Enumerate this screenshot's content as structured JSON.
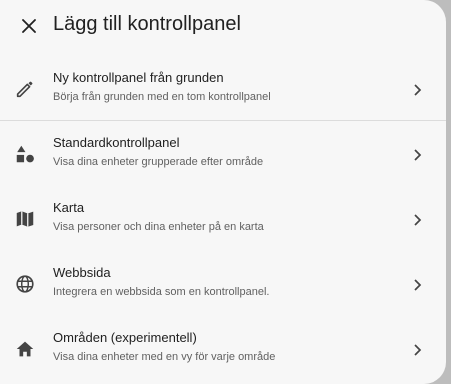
{
  "dialog": {
    "title": "Lägg till kontrollpanel",
    "close_icon": "close-icon"
  },
  "items": [
    {
      "label": "Ny kontrollpanel från grunden",
      "description": "Börja från grunden med en tom kontrollpanel",
      "icon": "pencil-icon"
    },
    {
      "label": "Standardkontrollpanel",
      "description": "Visa dina enheter grupperade efter område",
      "icon": "shapes-icon"
    },
    {
      "label": "Karta",
      "description": "Visa personer och dina enheter på en karta",
      "icon": "map-icon"
    },
    {
      "label": "Webbsida",
      "description": "Integrera en webbsida som en kontrollpanel.",
      "icon": "web-icon"
    },
    {
      "label": "Områden (experimentell)",
      "description": "Visa dina enheter med en vy för varje område",
      "icon": "home-icon"
    }
  ],
  "colors": {
    "dialog_bg": "#f7f7f7",
    "text_primary": "#212121",
    "text_secondary": "#616161",
    "icon": "#444444",
    "divider": "#dcdcdc"
  }
}
